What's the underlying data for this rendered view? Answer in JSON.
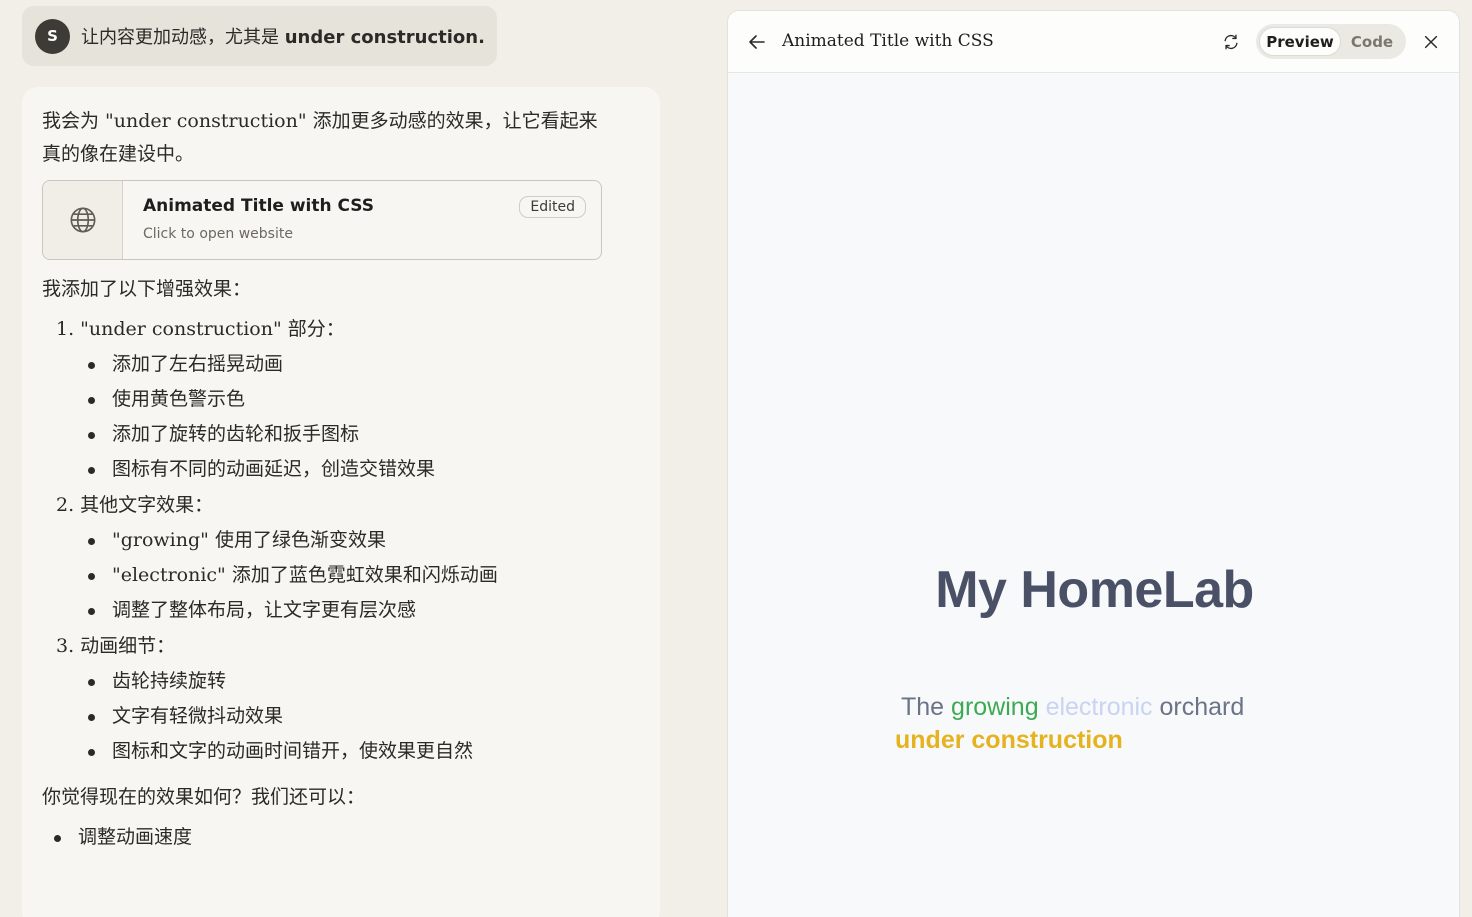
{
  "user_message": {
    "avatar_letter": "S",
    "text_prefix": "让内容更加动感，尤其是 ",
    "text_bold": "under construction."
  },
  "assistant": {
    "intro": "我会为 \"under construction\" 添加更多动感的效果，让它看起来真的像在建设中。",
    "artifact": {
      "title": "Animated Title with CSS",
      "subtitle": "Click to open website",
      "badge": "Edited",
      "icon": "globe-icon"
    },
    "enhancements_heading": "我添加了以下增强效果：",
    "sections": [
      {
        "heading": "1. \"under construction\" 部分：",
        "items": [
          "添加了左右摇晃动画",
          "使用黄色警示色",
          "添加了旋转的齿轮和扳手图标",
          "图标有不同的动画延迟，创造交错效果"
        ]
      },
      {
        "heading": "2. 其他文字效果：",
        "items": [
          "\"growing\" 使用了绿色渐变效果",
          "\"electronic\" 添加了蓝色霓虹效果和闪烁动画",
          "调整了整体布局，让文字更有层次感"
        ]
      },
      {
        "heading": "3. 动画细节：",
        "items": [
          "齿轮持续旋转",
          "文字有轻微抖动效果",
          "图标和文字的动画时间错开，使效果更自然"
        ]
      }
    ],
    "question": "你觉得现在的效果如何？我们还可以：",
    "options": [
      "调整动画速度"
    ]
  },
  "panel": {
    "title": "Animated Title with CSS",
    "toggle": {
      "preview": "Preview",
      "code": "Code",
      "active": "preview"
    },
    "icons": {
      "back": "arrow-left-icon",
      "refresh": "refresh-icon",
      "close": "close-icon"
    }
  },
  "preview_content": {
    "heading": "My HomeLab",
    "tagline_the": "The",
    "tagline_growing": "growing",
    "tagline_electronic": "electronic",
    "tagline_orchard": "orchard",
    "tagline_construction": "under construction",
    "colors": {
      "heading": "#4a5166",
      "growing": "#3daa52",
      "electronic": "#c9d3f2",
      "construction": "#e5b320"
    }
  }
}
